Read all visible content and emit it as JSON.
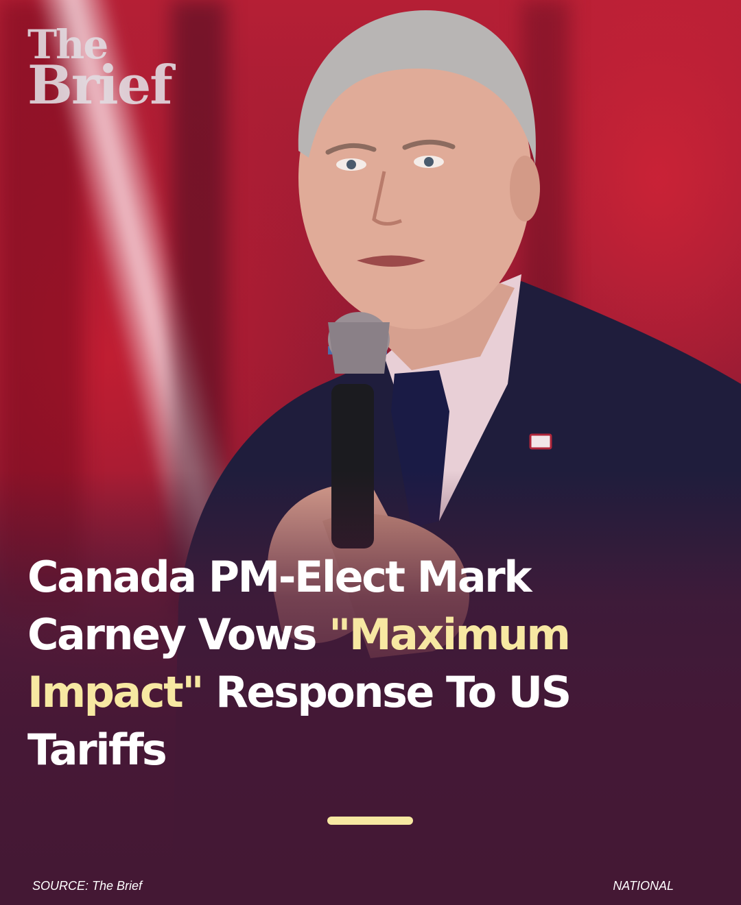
{
  "logo": {
    "line1": "The",
    "line2": "Brief"
  },
  "headline": {
    "part1": "Canada PM-Elect Mark Carney Vows ",
    "highlight": "\"Maximum Impact\"",
    "part2": " Response To US Tariffs"
  },
  "footer": {
    "source": "SOURCE: The Brief",
    "category": "NATIONAL"
  },
  "colors": {
    "highlight": "#f7e8a2",
    "background": "#4a1a38",
    "text": "#ffffff"
  }
}
